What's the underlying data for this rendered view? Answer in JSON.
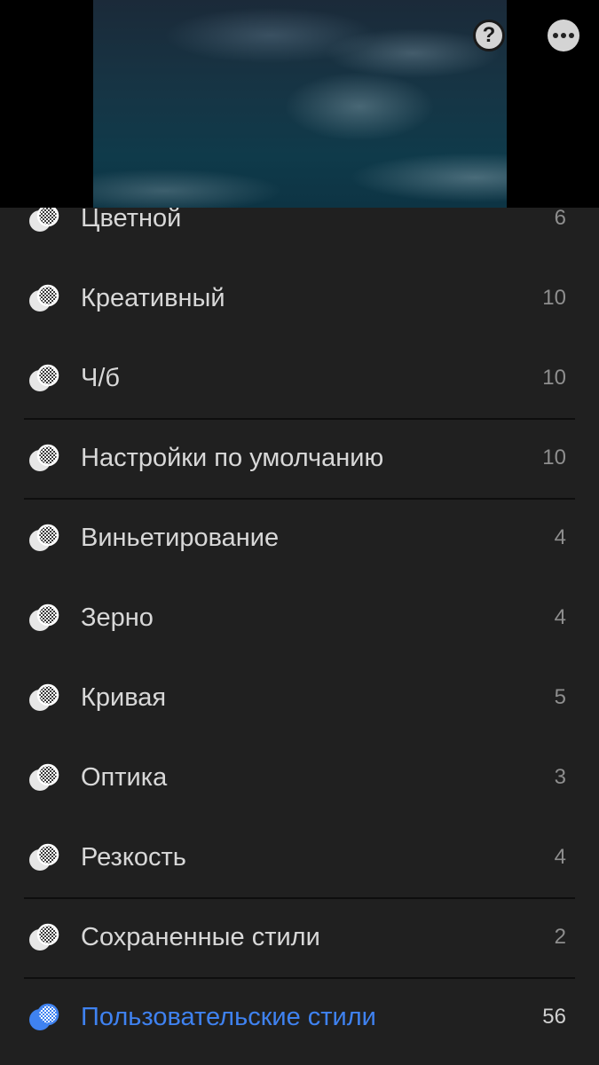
{
  "colors": {
    "panel_bg": "#202020",
    "text": "#d8d8d8",
    "count": "#8e8e8e",
    "accent": "#3f82f0",
    "divider": "#0e0e0e"
  },
  "toolbar": {
    "help_icon": "question-circle-icon",
    "help_glyph": "?",
    "more_icon": "more-horizontal-icon"
  },
  "presets": [
    {
      "label": "Цветной",
      "count": "6",
      "icon": "preset-group-icon",
      "active": false
    },
    {
      "label": "Креативный",
      "count": "10",
      "icon": "preset-group-icon",
      "active": false
    },
    {
      "label": "Ч/б",
      "count": "10",
      "icon": "preset-group-icon",
      "active": false
    },
    {
      "label": "Настройки по умолчанию",
      "count": "10",
      "icon": "preset-group-icon",
      "active": false
    },
    {
      "label": "Виньетирование",
      "count": "4",
      "icon": "preset-group-icon",
      "active": false
    },
    {
      "label": "Зерно",
      "count": "4",
      "icon": "preset-group-icon",
      "active": false
    },
    {
      "label": "Кривая",
      "count": "5",
      "icon": "preset-group-icon",
      "active": false
    },
    {
      "label": "Оптика",
      "count": "3",
      "icon": "preset-group-icon",
      "active": false
    },
    {
      "label": "Резкость",
      "count": "4",
      "icon": "preset-group-icon",
      "active": false
    },
    {
      "label": "Сохраненные стили",
      "count": "2",
      "icon": "preset-group-icon",
      "active": false
    },
    {
      "label": "Пользовательские стили",
      "count": "56",
      "icon": "preset-group-icon",
      "active": true
    }
  ]
}
